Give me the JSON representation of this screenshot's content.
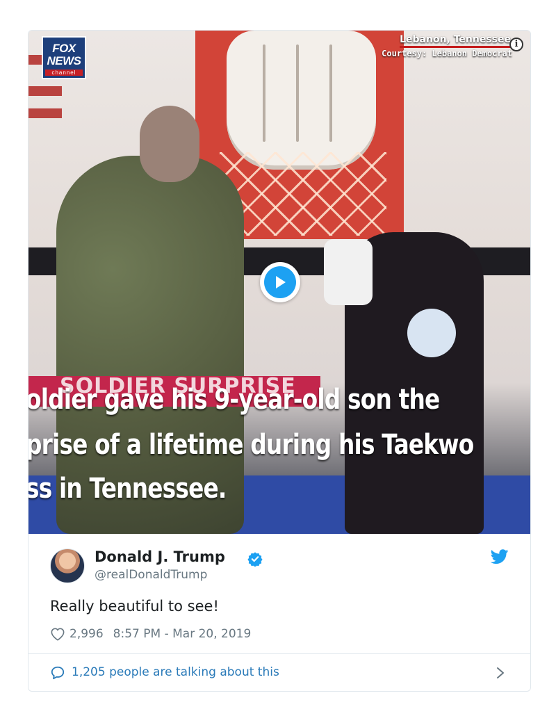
{
  "video": {
    "logo_text": "FOX NEWS",
    "logo_sub": "channel",
    "location": "Lebanon, Tennessee",
    "courtesy": "Courtesy: Lebanon Democrat",
    "tag": "SOLDIER SURPRISE",
    "caption_lines": [
      "oldier gave his 9-year-old son the",
      "prise of a lifetime during his Taekwo",
      "ss in Tennessee."
    ],
    "info_icon_glyph": "i"
  },
  "tweet": {
    "name": "Donald J. Trump",
    "handle": "@realDonaldTrump",
    "text": "Really beautiful to see!",
    "likes": "2,996",
    "timestamp": "8:57 PM - Mar 20, 2019",
    "talking": "1,205 people are talking about this"
  },
  "icons": {
    "info": "info-icon",
    "play": "play-icon",
    "verified": "verified-badge-icon",
    "twitter": "twitter-bird-icon",
    "heart": "heart-icon",
    "bubble": "speech-bubble-icon",
    "chevron": "chevron-right-icon"
  },
  "colors": {
    "twitter_blue": "#1da1f2",
    "link_blue": "#2b7bb9",
    "meta_gray": "#697882",
    "text": "#1c2022",
    "fox_blue": "#1d3f7b",
    "fox_red": "#c62026",
    "tag_pink": "#c3264c"
  }
}
